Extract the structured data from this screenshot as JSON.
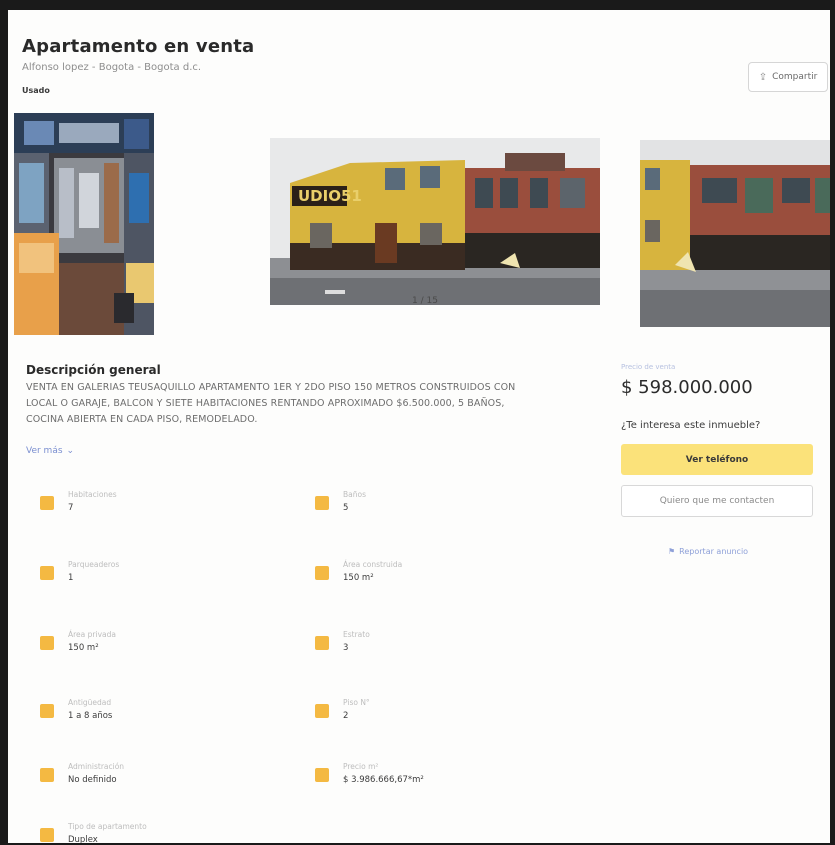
{
  "header": {
    "title": "Apartamento en venta",
    "location": "Alfonso lopez - Bogota - Bogota d.c.",
    "condition_badge": "Usado",
    "share_label": "Compartir",
    "share_icon": "share-icon"
  },
  "gallery": {
    "counter": "1 / 15"
  },
  "description": {
    "title": "Descripción general",
    "text": "VENTA EN GALERIAS TEUSAQUILLO APARTAMENTO 1ER Y 2DO PISO 150 METROS CONSTRUIDOS CON LOCAL O GARAJE, BALCON Y SIETE HABITACIONES RENTANDO APROXIMADO $6.500.000, 5 BAÑOS, COCINA ABIERTA EN CADA PISO, REMODELADO.",
    "see_more": "Ver más"
  },
  "features": [
    {
      "label": "Habitaciones",
      "value": "7",
      "icon": "bed-icon",
      "color": "#f4b942"
    },
    {
      "label": "Baños",
      "value": "5",
      "icon": "bath-icon",
      "color": "#f4b942"
    },
    {
      "label": "Parqueaderos",
      "value": "1",
      "icon": "car-icon",
      "color": "#f4b942"
    },
    {
      "label": "Área construida",
      "value": "150 m²",
      "icon": "area-icon",
      "color": "#f4b942"
    },
    {
      "label": "Área privada",
      "value": "150 m²",
      "icon": "ruler-icon",
      "color": "#f4b942"
    },
    {
      "label": "Estrato",
      "value": "3",
      "icon": "house-icon",
      "color": "#f4b942"
    },
    {
      "label": "Antigüedad",
      "value": "1 a 8 años",
      "icon": "clock-icon",
      "color": "#f4b942"
    },
    {
      "label": "Piso N°",
      "value": "2",
      "icon": "floor-icon",
      "color": "#f4b942"
    },
    {
      "label": "Administración",
      "value": "No definido",
      "icon": "money-icon",
      "color": "#f4b942"
    },
    {
      "label": "Precio m²",
      "value": "$ 3.986.666,67*m²",
      "icon": "tag-icon",
      "color": "#f4b942"
    },
    {
      "label": "Tipo de apartamento",
      "value": "Duplex",
      "icon": "home-icon",
      "color": "#f4b942"
    }
  ],
  "pricing": {
    "label": "Precio de venta",
    "price": "$ 598.000.000",
    "question": "¿Te interesa este inmueble?",
    "phone_button": "Ver teléfono",
    "contact_button": "Quiero que me contacten",
    "report_label": "Reportar anuncio",
    "accent_color": "#fbe27a"
  }
}
